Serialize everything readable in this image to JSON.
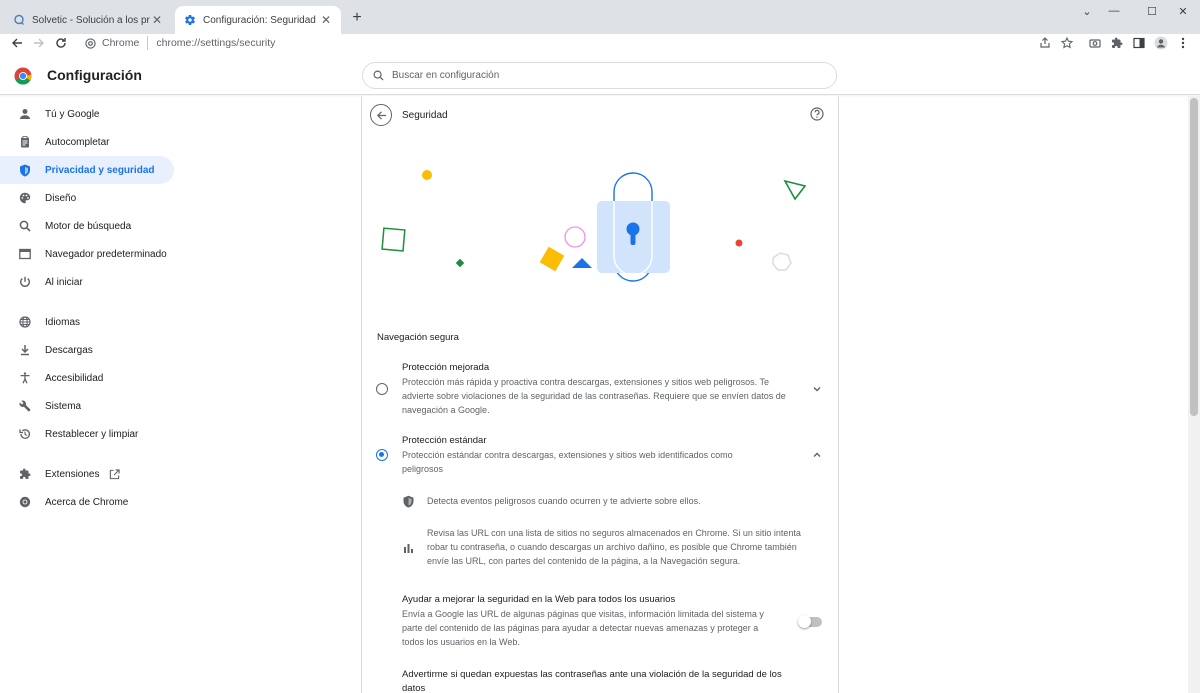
{
  "tabs": [
    {
      "title": "Solvetic - Solución a los problem",
      "icon": "solvetic-favicon",
      "active": false
    },
    {
      "title": "Configuración: Seguridad",
      "icon": "gear-icon",
      "active": true
    }
  ],
  "toolbar": {
    "site_label": "Chrome",
    "url": "chrome://settings/security"
  },
  "settings": {
    "title": "Configuración",
    "search_placeholder": "Buscar en configuración"
  },
  "sidebar": {
    "items": [
      {
        "label": "Tú y Google",
        "icon": "person-icon"
      },
      {
        "label": "Autocompletar",
        "icon": "clipboard-icon"
      },
      {
        "label": "Privacidad y seguridad",
        "icon": "shield-icon",
        "selected": true
      },
      {
        "label": "Diseño",
        "icon": "palette-icon"
      },
      {
        "label": "Motor de búsqueda",
        "icon": "search-icon"
      },
      {
        "label": "Navegador predeterminado",
        "icon": "browser-icon"
      },
      {
        "label": "Al iniciar",
        "icon": "power-icon"
      },
      {
        "label": "Idiomas",
        "icon": "globe-icon"
      },
      {
        "label": "Descargas",
        "icon": "download-icon"
      },
      {
        "label": "Accesibilidad",
        "icon": "accessibility-icon"
      },
      {
        "label": "Sistema",
        "icon": "wrench-icon"
      },
      {
        "label": "Restablecer y limpiar",
        "icon": "restore-icon"
      },
      {
        "label": "Extensiones",
        "icon": "puzzle-icon"
      },
      {
        "label": "Acerca de Chrome",
        "icon": "chrome-icon"
      }
    ]
  },
  "page": {
    "title": "Seguridad",
    "section_label": "Navegación segura",
    "options": [
      {
        "title": "Protección mejorada",
        "description": "Protección más rápida y proactiva contra descargas, extensiones y sitios web peligrosos. Te advierte sobre violaciones de la seguridad de las contraseñas. Requiere que se envíen datos de navegación a Google.",
        "checked": false,
        "expanded": false
      },
      {
        "title": "Protección estándar",
        "description": "Protección estándar contra descargas, extensiones y sitios web identificados como peligrosos",
        "checked": true,
        "expanded": true
      }
    ],
    "bullets": [
      {
        "text": "Detecta eventos peligrosos cuando ocurren y te advierte sobre ellos.",
        "icon": "shield-icon"
      },
      {
        "text": "Revisa las URL con una lista de sitios no seguros almacenados en Chrome. Si un sitio intenta robar tu contraseña, o cuando descargas un archivo dañino, es posible que Chrome también envíe las URL, con partes del contenido de la página, a la Navegación segura.",
        "icon": "bar-chart-icon"
      }
    ],
    "toggles": [
      {
        "title": "Ayudar a mejorar la seguridad en la Web para todos los usuarios",
        "description": "Envía a Google las URL de algunas páginas que visitas, información limitada del sistema y parte del contenido de las páginas para ayudar a detectar nuevas amenazas y proteger a todos los usuarios en la Web.",
        "on": false
      },
      {
        "title": "Advertirme si quedan expuestas las contraseñas ante una violación de la seguridad de los datos"
      }
    ]
  },
  "colors": {
    "accent": "#1a73e8",
    "tabstrip": "#dee1e6",
    "selected_bg": "#e8f0fe"
  }
}
